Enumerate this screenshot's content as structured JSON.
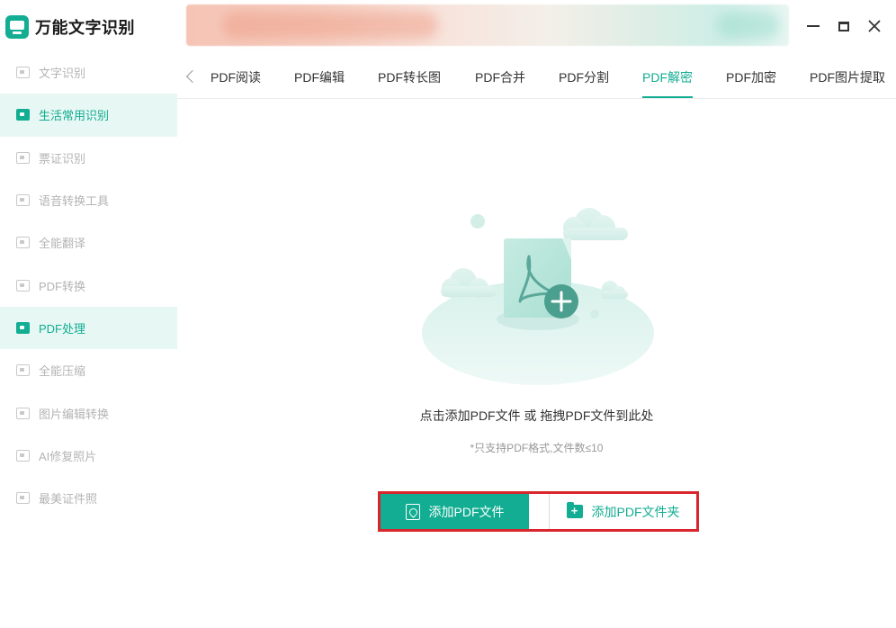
{
  "app": {
    "title": "万能文字识别"
  },
  "sidebar": {
    "items": [
      {
        "label": "文字识别",
        "icon": "text-scan-icon",
        "active": false
      },
      {
        "label": "生活常用识别",
        "icon": "life-scan-icon",
        "active": true
      },
      {
        "label": "票证识别",
        "icon": "ticket-scan-icon",
        "active": false
      },
      {
        "label": "语音转换工具",
        "icon": "voice-convert-icon",
        "active": false
      },
      {
        "label": "全能翻译",
        "icon": "translate-icon",
        "active": false
      },
      {
        "label": "PDF转换",
        "icon": "pdf-convert-icon",
        "active": false
      },
      {
        "label": "PDF处理",
        "icon": "pdf-process-icon",
        "active": true
      },
      {
        "label": "全能压缩",
        "icon": "compress-icon",
        "active": false
      },
      {
        "label": "图片编辑转换",
        "icon": "image-edit-icon",
        "active": false
      },
      {
        "label": "AI修复照片",
        "icon": "ai-repair-icon",
        "active": false
      },
      {
        "label": "最美证件照",
        "icon": "id-photo-icon",
        "active": false
      }
    ]
  },
  "tabs": [
    {
      "label": "PDF阅读",
      "active": false
    },
    {
      "label": "PDF编辑",
      "active": false
    },
    {
      "label": "PDF转长图",
      "active": false
    },
    {
      "label": "PDF合并",
      "active": false
    },
    {
      "label": "PDF分割",
      "active": false
    },
    {
      "label": "PDF解密",
      "active": true
    },
    {
      "label": "PDF加密",
      "active": false
    },
    {
      "label": "PDF图片提取",
      "active": false
    }
  ],
  "main": {
    "prompt": "点击添加PDF文件 或 拖拽PDF文件到此处",
    "hint": "*只支持PDF格式,文件数≤10",
    "add_file_label": "添加PDF文件",
    "add_folder_label": "添加PDF文件夹"
  },
  "colors": {
    "accent": "#12ad92",
    "active_bg": "#e7f7f3",
    "highlight_border": "#d9262c"
  }
}
